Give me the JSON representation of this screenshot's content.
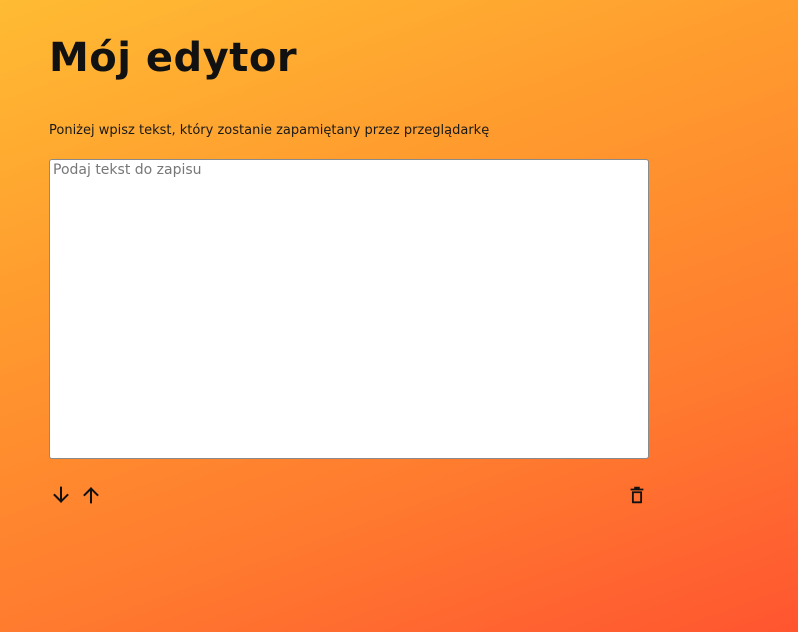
{
  "page": {
    "title": "Mój edytor",
    "description": "Poniżej wpisz tekst, który zostanie zapamiętany przez przeglądarkę"
  },
  "editor": {
    "value": "",
    "placeholder": "Podaj tekst do zapisu"
  },
  "toolbar": {
    "buttons": [
      {
        "icon": "arrow-down-icon"
      },
      {
        "icon": "arrow-up-icon"
      },
      {
        "icon": "trash-icon"
      }
    ]
  },
  "colors": {
    "gradient_start": "#ffbb33",
    "gradient_end": "#ff5530",
    "text": "#111111"
  }
}
